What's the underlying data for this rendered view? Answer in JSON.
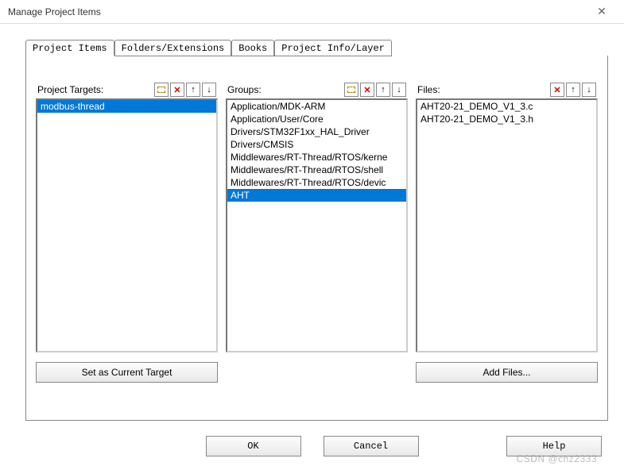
{
  "window": {
    "title": "Manage Project Items"
  },
  "tabs": {
    "items": [
      "Project Items",
      "Folders/Extensions",
      "Books",
      "Project Info/Layer"
    ],
    "active_index": 0
  },
  "columns": {
    "targets": {
      "label": "Project Targets:",
      "items": [
        "modbus-thread"
      ],
      "selected_index": 0,
      "button": "Set as Current Target"
    },
    "groups": {
      "label": "Groups:",
      "items": [
        "Application/MDK-ARM",
        "Application/User/Core",
        "Drivers/STM32F1xx_HAL_Driver",
        "Drivers/CMSIS",
        "Middlewares/RT-Thread/RTOS/kerne",
        "Middlewares/RT-Thread/RTOS/shell",
        "Middlewares/RT-Thread/RTOS/devic",
        "AHT"
      ],
      "selected_index": 7
    },
    "files": {
      "label": "Files:",
      "items": [
        "AHT20-21_DEMO_V1_3.c",
        "AHT20-21_DEMO_V1_3.h"
      ],
      "selected_index": -1,
      "button": "Add Files..."
    }
  },
  "buttons": {
    "ok": "OK",
    "cancel": "Cancel",
    "help": "Help"
  },
  "watermark": "CSDN @chz2333"
}
